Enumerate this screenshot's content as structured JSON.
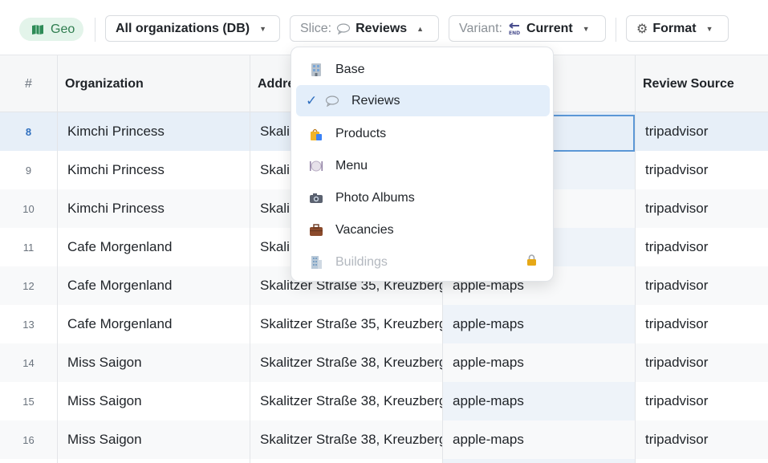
{
  "toolbar": {
    "geo_label": "Geo",
    "org_select": "All organizations (DB)",
    "slice_prefix": "Slice:",
    "slice_value": "Reviews",
    "variant_prefix": "Variant:",
    "variant_value": "Current",
    "format_label": "Format"
  },
  "columns": [
    "#",
    "Organization",
    "Addre",
    "",
    "Review Source"
  ],
  "rows": [
    {
      "num": "8",
      "org": "Kimchi Princess",
      "addr": "Skali",
      "src": "",
      "review_source": "tripadvisor"
    },
    {
      "num": "9",
      "org": "Kimchi Princess",
      "addr": "Skali",
      "src": "",
      "review_source": "tripadvisor"
    },
    {
      "num": "10",
      "org": "Kimchi Princess",
      "addr": "Skali",
      "src": "",
      "review_source": "tripadvisor"
    },
    {
      "num": "11",
      "org": "Cafe Morgenland",
      "addr": "Skali",
      "src": "",
      "review_source": "tripadvisor"
    },
    {
      "num": "12",
      "org": "Cafe Morgenland",
      "addr": "Skalitzer Straße 35, Kreuzberg",
      "src": "apple-maps",
      "review_source": "tripadvisor"
    },
    {
      "num": "13",
      "org": "Cafe Morgenland",
      "addr": "Skalitzer Straße 35, Kreuzberg",
      "src": "apple-maps",
      "review_source": "tripadvisor"
    },
    {
      "num": "14",
      "org": "Miss Saigon",
      "addr": "Skalitzer Straße 38, Kreuzberg",
      "src": "apple-maps",
      "review_source": "tripadvisor"
    },
    {
      "num": "15",
      "org": "Miss Saigon",
      "addr": "Skalitzer Straße 38, Kreuzberg",
      "src": "apple-maps",
      "review_source": "tripadvisor"
    },
    {
      "num": "16",
      "org": "Miss Saigon",
      "addr": "Skalitzer Straße 38, Kreuzberg",
      "src": "apple-maps",
      "review_source": "tripadvisor"
    }
  ],
  "slice_menu": {
    "items": [
      {
        "label": "Base",
        "icon": "building-icon"
      },
      {
        "label": "Reviews",
        "icon": "speech-bubble-icon",
        "selected": true
      },
      {
        "label": "Products",
        "icon": "shopping-bag-icon"
      },
      {
        "label": "Menu",
        "icon": "plate-icon"
      },
      {
        "label": "Photo Albums",
        "icon": "camera-icon"
      },
      {
        "label": "Vacancies",
        "icon": "briefcase-icon"
      },
      {
        "label": "Buildings",
        "icon": "office-building-icon",
        "disabled": true,
        "locked": true
      }
    ]
  },
  "colors": {
    "accent": "#2f6fbf",
    "geo_bg": "#e3f4ea",
    "geo_text": "#2f7d4f",
    "selected_row": "#e7eff8"
  }
}
